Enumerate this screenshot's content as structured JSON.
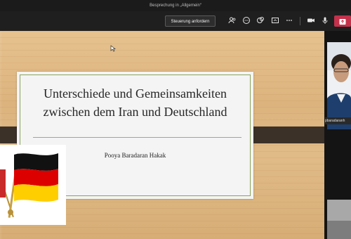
{
  "window": {
    "title": "Besprechung in „Allgemein“"
  },
  "toolbar": {
    "request_control_label": "Steuerung anfordern",
    "icons": [
      "people-icon",
      "chat-icon",
      "reactions-icon",
      "share-icon",
      "more-icon",
      "camera-icon",
      "mic-icon",
      "share-tray-icon",
      "leave-icon"
    ]
  },
  "slide": {
    "title_line1": "Unterschiede und Gemeinsamkeiten",
    "title_line2": "zwischen dem Iran und Deutschland",
    "author": "Pooya Baradaran Hakak"
  },
  "participant": {
    "name": "pbaradaranh"
  },
  "colors": {
    "leave": "#c4314b",
    "slide_accent": "#8aa35a",
    "flag_black": "#000000",
    "flag_red": "#dd0000",
    "flag_gold": "#ffce00"
  }
}
